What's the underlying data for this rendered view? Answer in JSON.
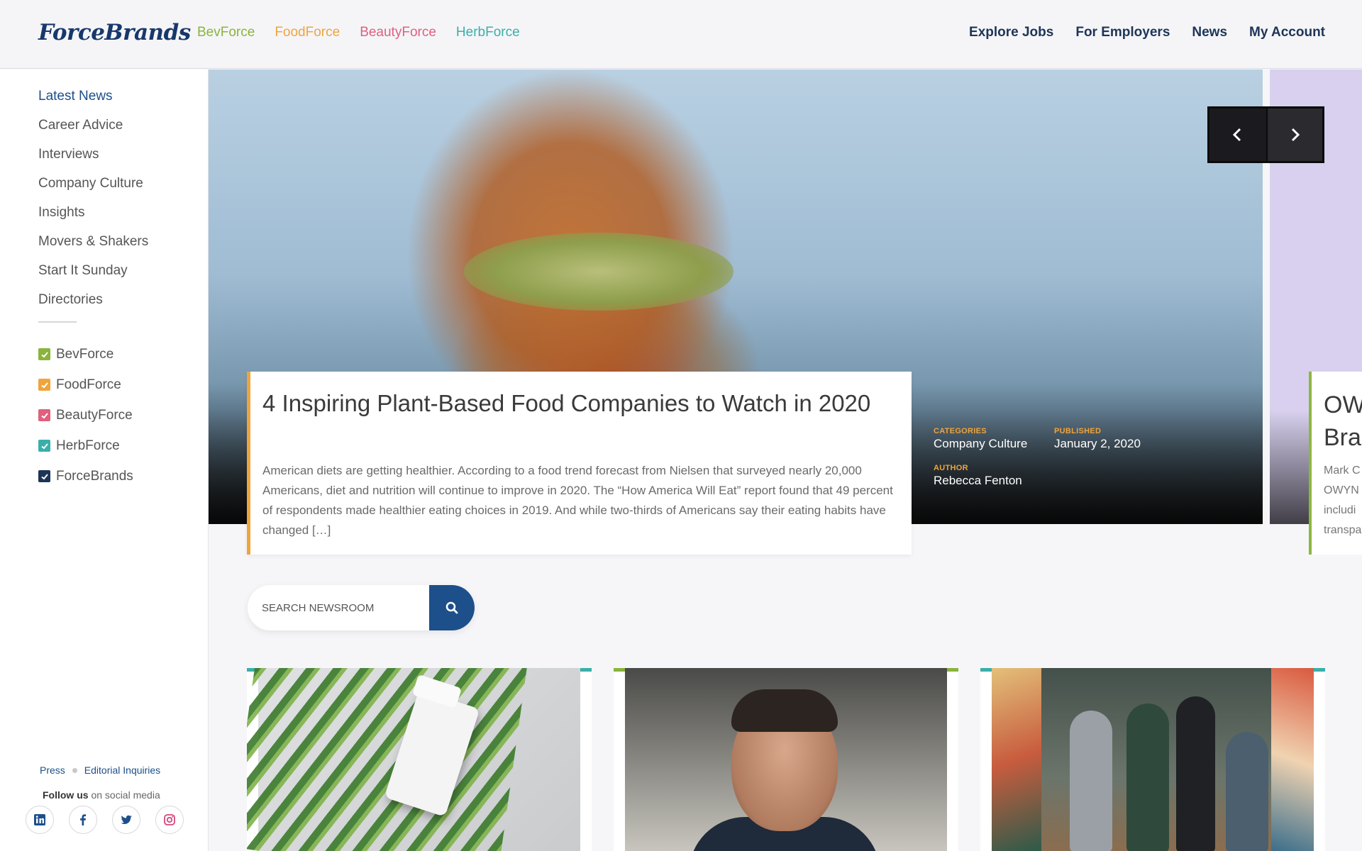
{
  "header": {
    "logo": "ForceBrands",
    "brand_links": [
      {
        "label": "BevForce",
        "color": "#8ab43c"
      },
      {
        "label": "FoodForce",
        "color": "#f0a43c"
      },
      {
        "label": "BeautyForce",
        "color": "#e0607e"
      },
      {
        "label": "HerbForce",
        "color": "#3aafa9"
      }
    ],
    "main_nav": [
      "Explore Jobs",
      "For Employers",
      "News",
      "My Account"
    ]
  },
  "sidebar": {
    "categories": [
      "Latest News",
      "Career Advice",
      "Interviews",
      "Company Culture",
      "Insights",
      "Movers & Shakers",
      "Start It Sunday",
      "Directories"
    ],
    "filters": [
      {
        "label": "BevForce",
        "color": "#8ab43c",
        "checked": true
      },
      {
        "label": "FoodForce",
        "color": "#f0a43c",
        "checked": true
      },
      {
        "label": "BeautyForce",
        "color": "#e0607e",
        "checked": true
      },
      {
        "label": "HerbForce",
        "color": "#3aafa9",
        "checked": true
      },
      {
        "label": "ForceBrands",
        "color": "#1d3557",
        "checked": true
      }
    ],
    "footer_links": [
      "Press",
      "Editorial Inquiries"
    ],
    "follow_bold": "Follow us",
    "follow_rest": " on social media",
    "socials": [
      "linkedin-icon",
      "facebook-icon",
      "twitter-icon",
      "instagram-icon"
    ]
  },
  "featured": {
    "title": "4 Inspiring Plant-Based Food Companies to Watch in 2020",
    "excerpt": "American diets are getting healthier. According to a food trend forecast from Nielsen that surveyed nearly 20,000 Americans, diet and nutrition will continue to improve in 2020. The “How America Will Eat” report found that 49 percent of respondents made healthier eating choices in 2019. And while two-thirds of Americans say their eating habits have changed […]",
    "categories_label": "CATEGORIES",
    "categories_value": "Company Culture",
    "published_label": "PUBLISHED",
    "published_value": "January 2, 2020",
    "author_label": "AUTHOR",
    "author_value": "Rebecca Fenton"
  },
  "next_slide": {
    "title": "OW\nBra",
    "excerpt": "Mark C\nOWYN\nincludi\ntranspa"
  },
  "search": {
    "placeholder": "SEARCH NEWSROOM"
  },
  "tiles": [
    {
      "accent": "#3aafa9"
    },
    {
      "accent": "#8ab43c"
    },
    {
      "accent": "#3aafa9"
    }
  ]
}
